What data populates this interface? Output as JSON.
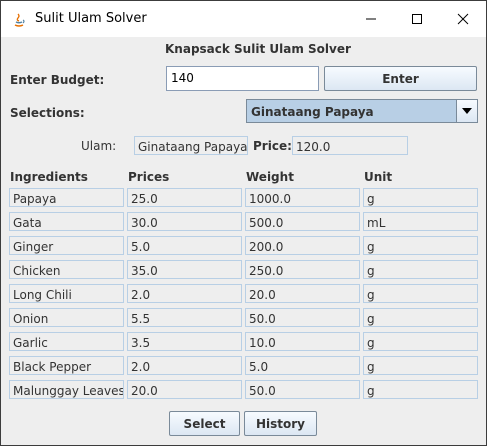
{
  "window": {
    "title": "Sulit Ulam Solver"
  },
  "header": {
    "heading": "Knapsack Sulit Ulam Solver"
  },
  "budget": {
    "label": "Enter Budget:",
    "value": "140",
    "enter_label": "Enter"
  },
  "selections": {
    "label": "Selections:",
    "selected": "Ginataang Papaya"
  },
  "ulam": {
    "label": "Ulam:",
    "value": "Ginataang Papaya",
    "price_label": "Price:",
    "price_value": "120.0"
  },
  "table": {
    "headers": [
      "Ingredients",
      "Prices",
      "Weight",
      "Unit"
    ],
    "rows": [
      [
        "Papaya",
        "25.0",
        "1000.0",
        "g"
      ],
      [
        "Gata",
        "30.0",
        "500.0",
        "mL"
      ],
      [
        "Ginger",
        "5.0",
        "200.0",
        "g"
      ],
      [
        "Chicken",
        "35.0",
        "250.0",
        "g"
      ],
      [
        "Long Chili",
        "2.0",
        "20.0",
        "g"
      ],
      [
        "Onion",
        "5.5",
        "50.0",
        "g"
      ],
      [
        "Garlic",
        "3.5",
        "10.0",
        "g"
      ],
      [
        "Black Pepper",
        "2.0",
        "5.0",
        "g"
      ],
      [
        "Malunggay Leaves",
        "20.0",
        "50.0",
        "g"
      ]
    ]
  },
  "actions": {
    "select_label": "Select",
    "history_label": "History"
  },
  "colors": {
    "accent": "#b8cfe5",
    "border": "#7a8a99",
    "background": "#eeeeee"
  }
}
